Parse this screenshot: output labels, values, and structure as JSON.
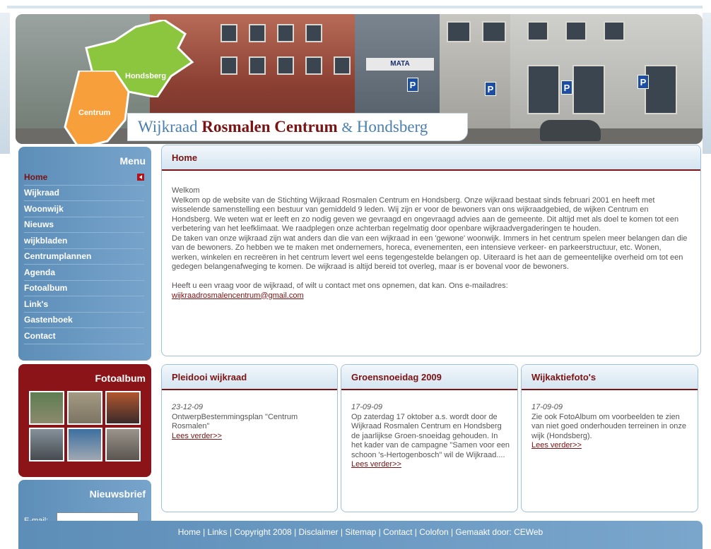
{
  "header": {
    "map_labels": {
      "hondsberg": "Hondsberg",
      "centrum": "Centrum"
    },
    "banner": {
      "w1": "Wijkraad",
      "w2": "Rosmalen Centrum",
      "w3": "&",
      "w4": "Hondsberg"
    },
    "shop_sign": "MATA"
  },
  "menu": {
    "title": "Menu",
    "items": [
      {
        "label": "Home",
        "active": true
      },
      {
        "label": "Wijkraad"
      },
      {
        "label": "Woonwijk"
      },
      {
        "label": "Nieuws"
      },
      {
        "label": "wijkbladen"
      },
      {
        "label": "Centrumplannen"
      },
      {
        "label": "Agenda"
      },
      {
        "label": "Fotoalbum"
      },
      {
        "label": "Link's"
      },
      {
        "label": "Gastenboek"
      },
      {
        "label": "Contact"
      }
    ]
  },
  "fotoalbum": {
    "title": "Fotoalbum"
  },
  "nieuwsbrief": {
    "title": "Nieuwsbrief",
    "email_label": "E-mail:"
  },
  "home": {
    "title": "Home",
    "greeting": "Welkom",
    "p1": "Welkom op de website van de Stichting Wijkraad Rosmalen Centrum en Hondsberg. Onze wijkraad bestaat sinds februari 2001 en heeft met wisselende samenstelling een bestuur van  gemiddeld 9 leden. Wij zijn er voor de bewoners van ons wijkraadgebied, de wijken Centrum en Hondsberg. We weten wat er leeft en zo nodig geven we gevraagd en ongevraagd advies aan de gemeente. Dit altijd met als doel te komen tot een verbetering van het leefklimaat. We raadplegen onze achterban regelmatig door openbare wijkraadvergaderingen te houden.",
    "p2": "De taken van onze wijkraad zijn wat anders dan die van een wijkraad in een 'gewone' woonwijk. Immers in het centrum spelen meer belangen dan die van de bewoners. Zo hebben we te maken met ondernemers, horeca, evenementen, een intensieve verkeer- en parkeerstructuur, etc. Wonen, werken, winkelen en recreëren in het centrum levert wel eens tegengestelde belangen op. Uiteraard is het aan de gemeentelijke overheid om tot een gedegen belangenafweging te komen. De wijkraad is altijd bereid tot overleg, maar is er bovenal voor de bewoners.",
    "p3": "Heeft u een vraag voor de wijkraad, of wilt u contact met ons opnemen, dat kan. Ons e-mailadres:",
    "email": "wijkraadrosmalencentrum@gmail.com"
  },
  "news": [
    {
      "title": "Pleidooi wijkraad",
      "date": "23-12-09",
      "text": "OntwerpBestemmingsplan \"Centrum Rosmalen\"",
      "link": "Lees verder>>"
    },
    {
      "title": "Groensnoeidag 2009",
      "date": "17-09-09",
      "text": "Op zaterdag 17 oktober a.s. wordt door de Wijkraad Rosmalen Centrum en Hondsberg de jaarlijkse Groen-snoeidag gehouden. In het kader van de campagne \"Samen voor een schoon 's-Hertogenbosch\" wil de Wijkraad....",
      "link": "Lees verder>>"
    },
    {
      "title": "Wijkaktiefoto's",
      "date": "17-09-09",
      "text": "Zie ook FotoAlbum om voorbeelden te zien van niet goed onderhouden terreinen in onze wijk (Hondsberg).",
      "link": "Lees verder>>"
    }
  ],
  "footer": "Home | Links | Copyright 2008 | Disclaimer | Sitemap | Contact | Colofon | Gemaakt door: CEWeb",
  "colors": {
    "accent_red": "#7a1313",
    "menu_blue": "#5d8eb8",
    "album_red": "#8a1417"
  }
}
